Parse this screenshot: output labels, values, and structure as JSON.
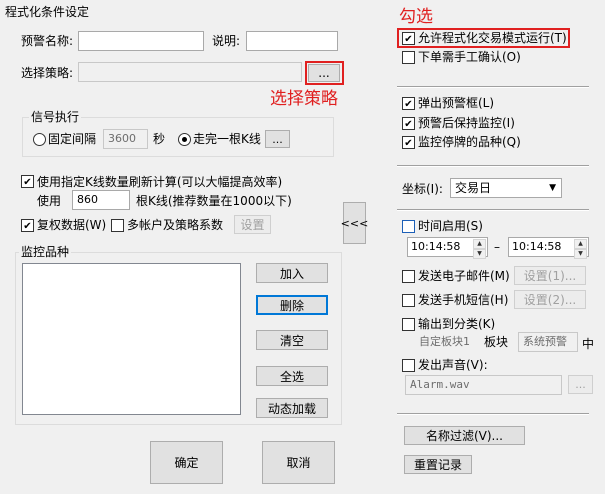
{
  "window": {
    "title": "程式化条件设定"
  },
  "left": {
    "alert_name_label": "预警名称:",
    "alert_name_value": "",
    "desc_label": "说明:",
    "desc_value": "",
    "strategy_label": "选择策略:",
    "strategy_value": "",
    "strategy_browse": "...",
    "signal": {
      "title": "信号执行",
      "fixed_interval": "固定间隔",
      "interval_value": "3600",
      "seconds": "秒",
      "per_bar": "走完一根K线",
      "per_bar_btn": "..."
    },
    "kline_refresh": "使用指定K线数量刷新计算(可以大幅提高效率)",
    "use_label": "使用",
    "use_value": "860",
    "kline_hint": "根K线(推荐数量在1000以下)",
    "adjust_data": "复权数据(W)",
    "multi_account": "多帐户及策略系数",
    "settings_btn": "设置",
    "collapse_btn": "<<<",
    "monitor": {
      "title": "监控品种",
      "add": "加入",
      "delete": "删除",
      "clear": "清空",
      "select_all": "全选",
      "dynamic_load": "动态加载"
    },
    "ok": "确定",
    "cancel": "取消"
  },
  "right": {
    "allow_program_trade": "允许程式化交易模式运行(T)",
    "manual_confirm": "下单需手工确认(O)",
    "popup_alert": "弹出预警框(L)",
    "keep_monitor": "预警后保持监控(I)",
    "monitor_suspended": "监控停牌的品种(Q)",
    "coord_label": "坐标(I):",
    "coord_value": "交易日",
    "time_enable": "时间启用(S)",
    "time_start": "10:14:58",
    "time_dash": "–",
    "time_end": "10:14:58",
    "send_email": "发送电子邮件(M)",
    "email_settings": "设置(1)...",
    "send_sms": "发送手机短信(H)",
    "sms_settings": "设置(2)...",
    "output_category": "输出到分类(K)",
    "output_block": "自定板块1",
    "block_label": "板块",
    "block_value": "系统预警",
    "block_suffix": "中",
    "play_sound": "发出声音(V):",
    "sound_file": "Alarm.wav",
    "sound_browse": "...",
    "name_filter": "名称过滤(V)...",
    "reset_record": "重置记录"
  },
  "annotations": {
    "tick_label": "勾选",
    "select_strategy": "选择策略"
  },
  "colors": {
    "annotation_red": "#e02020",
    "focus_blue": "#0078d7"
  }
}
